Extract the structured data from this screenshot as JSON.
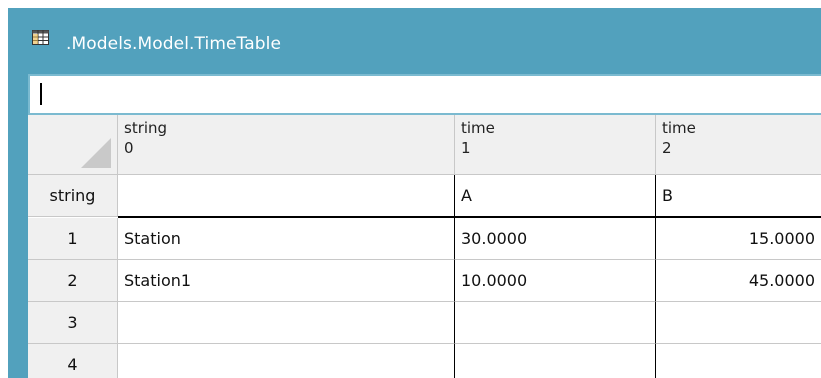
{
  "window": {
    "title": ".Models.Model.TimeTable",
    "title_icon": "table-icon",
    "accent_color": "#52a1bd"
  },
  "formula_bar": {
    "value": ""
  },
  "table": {
    "corner_icon": "select-all-triangle",
    "columns": [
      {
        "type": "string",
        "index": "0"
      },
      {
        "type": "time",
        "index": "1"
      },
      {
        "type": "time",
        "index": "2"
      }
    ],
    "header_row": {
      "label": "string",
      "values": [
        "",
        "A",
        "B"
      ]
    },
    "rows": [
      {
        "label": "1",
        "values": [
          "Station",
          "30.0000",
          "15.0000"
        ]
      },
      {
        "label": "2",
        "values": [
          "Station1",
          "10.0000",
          "45.0000"
        ]
      },
      {
        "label": "3",
        "values": [
          "",
          "",
          ""
        ]
      },
      {
        "label": "4",
        "values": [
          "",
          "",
          ""
        ]
      }
    ]
  }
}
